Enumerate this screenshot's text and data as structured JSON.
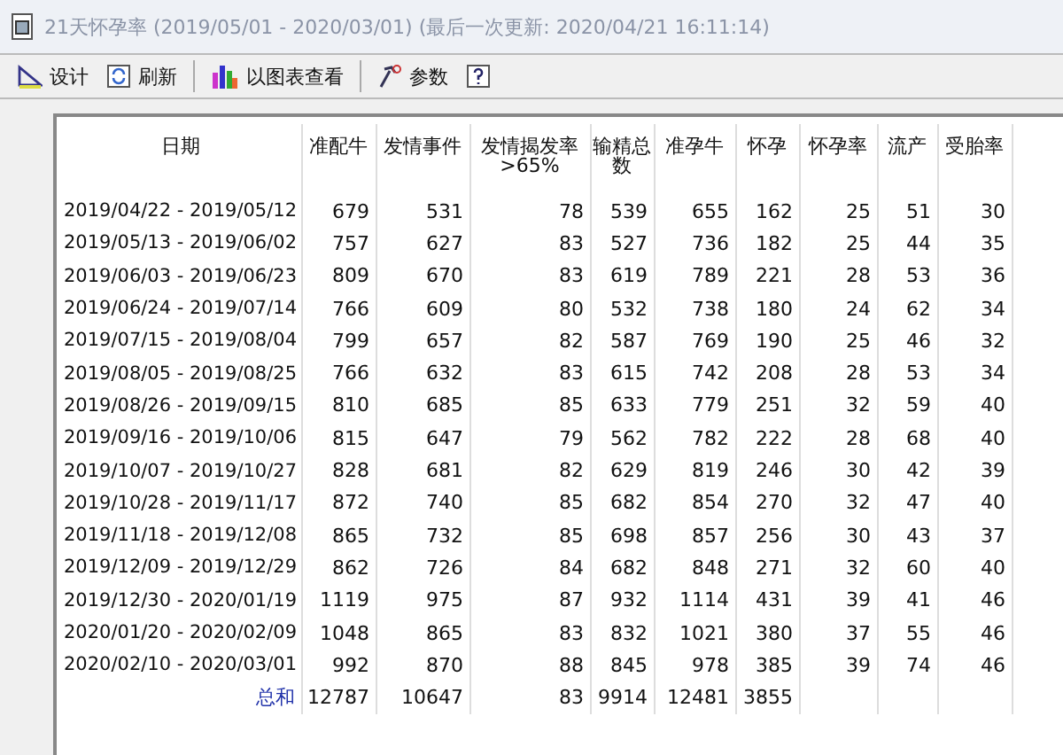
{
  "window": {
    "title": "21天怀孕率 (2019/05/01 - 2020/03/01) (最后一次更新: 2020/04/21 16:11:14)"
  },
  "toolbar": [
    {
      "kind": "design",
      "label": "设计"
    },
    {
      "kind": "refresh",
      "label": "刷新"
    },
    {
      "kind": "chart",
      "label": "以图表查看"
    },
    {
      "kind": "params",
      "label": "参数"
    },
    {
      "kind": "help"
    }
  ],
  "table": {
    "columns": [
      {
        "label": "日期"
      },
      {
        "label": "准配牛"
      },
      {
        "label": "发情事件"
      },
      {
        "label": "发情揭发率 >65%"
      },
      {
        "label": "输精总数"
      },
      {
        "label": "准孕牛"
      },
      {
        "label": "怀孕"
      },
      {
        "label": "怀孕率"
      },
      {
        "label": "流产"
      },
      {
        "label": "受胎率"
      }
    ],
    "rows": [
      [
        "2019/04/22 - 2019/05/12",
        "679",
        "531",
        "78",
        "539",
        "655",
        "162",
        "25",
        "51",
        "30"
      ],
      [
        "2019/05/13 - 2019/06/02",
        "757",
        "627",
        "83",
        "527",
        "736",
        "182",
        "25",
        "44",
        "35"
      ],
      [
        "2019/06/03 - 2019/06/23",
        "809",
        "670",
        "83",
        "619",
        "789",
        "221",
        "28",
        "53",
        "36"
      ],
      [
        "2019/06/24 - 2019/07/14",
        "766",
        "609",
        "80",
        "532",
        "738",
        "180",
        "24",
        "62",
        "34"
      ],
      [
        "2019/07/15 - 2019/08/04",
        "799",
        "657",
        "82",
        "587",
        "769",
        "190",
        "25",
        "46",
        "32"
      ],
      [
        "2019/08/05 - 2019/08/25",
        "766",
        "632",
        "83",
        "615",
        "742",
        "208",
        "28",
        "53",
        "34"
      ],
      [
        "2019/08/26 - 2019/09/15",
        "810",
        "685",
        "85",
        "633",
        "779",
        "251",
        "32",
        "59",
        "40"
      ],
      [
        "2019/09/16 - 2019/10/06",
        "815",
        "647",
        "79",
        "562",
        "782",
        "222",
        "28",
        "68",
        "40"
      ],
      [
        "2019/10/07 - 2019/10/27",
        "828",
        "681",
        "82",
        "629",
        "819",
        "246",
        "30",
        "42",
        "39"
      ],
      [
        "2019/10/28 - 2019/11/17",
        "872",
        "740",
        "85",
        "682",
        "854",
        "270",
        "32",
        "47",
        "40"
      ],
      [
        "2019/11/18 - 2019/12/08",
        "865",
        "732",
        "85",
        "698",
        "857",
        "256",
        "30",
        "43",
        "37"
      ],
      [
        "2019/12/09 - 2019/12/29",
        "862",
        "726",
        "84",
        "682",
        "848",
        "271",
        "32",
        "60",
        "40"
      ],
      [
        "2019/12/30 - 2020/01/19",
        "1119",
        "975",
        "87",
        "932",
        "1114",
        "431",
        "39",
        "41",
        "46"
      ],
      [
        "2020/01/20 - 2020/02/09",
        "1048",
        "865",
        "83",
        "832",
        "1021",
        "380",
        "37",
        "55",
        "46"
      ],
      [
        "2020/02/10 - 2020/03/01",
        "992",
        "870",
        "88",
        "845",
        "978",
        "385",
        "39",
        "74",
        "46"
      ]
    ],
    "total": [
      "总和",
      "12787",
      "10647",
      "83",
      "9914",
      "12481",
      "3855"
    ]
  }
}
